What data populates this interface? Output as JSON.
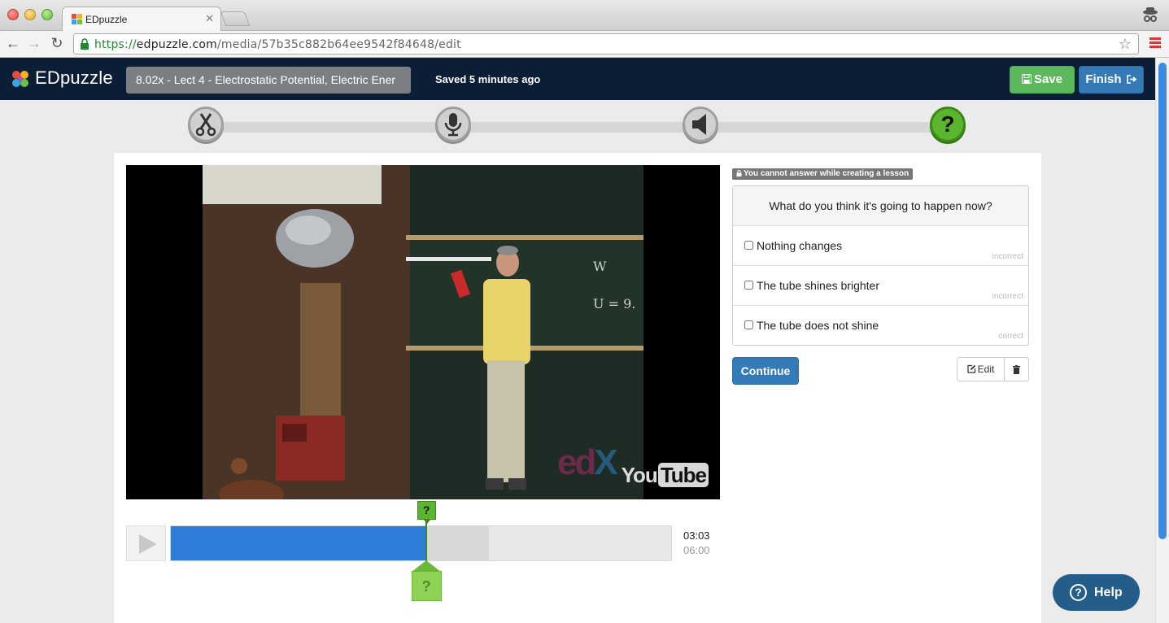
{
  "browser": {
    "tab_title": "EDpuzzle",
    "url_scheme": "https://",
    "url_host": "edpuzzle.com",
    "url_path": "/media/57b35c882b64ee9542f84648/edit"
  },
  "header": {
    "logo_text": "EDpuzzle",
    "video_title": "8.02x - Lect 4 - Electrostatic Potential, Electric Ener",
    "saved_status": "Saved 5 minutes ago",
    "save_label": "Save",
    "finish_label": "Finish"
  },
  "steps": [
    {
      "name": "cut",
      "icon": "scissors-icon"
    },
    {
      "name": "voiceover",
      "icon": "microphone-icon"
    },
    {
      "name": "audio-notes",
      "icon": "speaker-icon"
    },
    {
      "name": "quiz",
      "icon": "question-icon",
      "label": "?",
      "active": true
    }
  ],
  "video": {
    "watermark_you": "You",
    "watermark_tube": "Tube",
    "current_time": "03:03",
    "total_time": "06:00",
    "progress_fraction": 0.51,
    "buffered_fraction": 0.635,
    "marker_label": "?"
  },
  "question": {
    "notice": "You cannot answer while creating a lesson",
    "text": "What do you think it's going to happen now?",
    "options": [
      {
        "label": "Nothing changes",
        "tag": "incorrect"
      },
      {
        "label": "The tube shines brighter",
        "tag": "incorrect"
      },
      {
        "label": "The tube does not shine",
        "tag": "correct"
      }
    ],
    "continue_label": "Continue",
    "edit_label": "Edit"
  },
  "help": {
    "label": "Help",
    "icon_text": "?"
  },
  "colors": {
    "header_bg": "#0c1e36",
    "save_green": "#5cb85c",
    "primary_blue": "#337ab7",
    "progress_blue": "#2e7ed9",
    "quiz_green": "#5cb52e"
  }
}
